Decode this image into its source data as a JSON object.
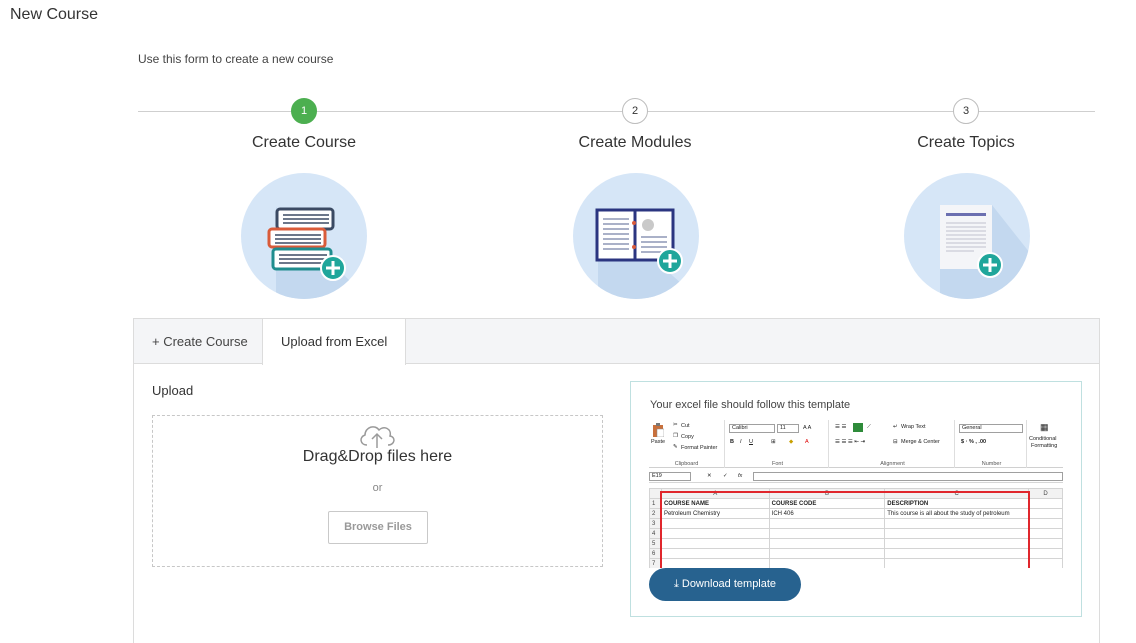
{
  "page": {
    "title": "New Course",
    "description": "Use this form to create a new course"
  },
  "steps": [
    {
      "number": "1",
      "label": "Create Course",
      "active": true
    },
    {
      "number": "2",
      "label": "Create Modules",
      "active": false
    },
    {
      "number": "3",
      "label": "Create Topics",
      "active": false
    }
  ],
  "tabs": [
    {
      "label": "+ Create Course",
      "active": false
    },
    {
      "label": "Upload from Excel",
      "active": true
    }
  ],
  "upload": {
    "label": "Upload",
    "drop_title": "Drag&Drop files here",
    "or_text": "or",
    "browse_label": "Browse Files"
  },
  "template": {
    "caption": "Your excel file should follow this template",
    "download_label": "Download template",
    "download_icon": "download-arrow-icon",
    "ribbon": {
      "paste": "Paste",
      "cut": "Cut",
      "copy": "Copy",
      "format_painter": "Format Painter",
      "clipboard": "Clipboard",
      "font_name": "Calibri",
      "font_size": "11",
      "font_group": "Font",
      "wrap_text": "Wrap Text",
      "merge_center": "Merge & Center",
      "alignment": "Alignment",
      "number_format": "General",
      "number": "Number",
      "conditional": "Conditional",
      "formatting": "Formatting"
    },
    "cell_ref": "E19",
    "fx": "fx",
    "columns": [
      "A",
      "B",
      "C",
      "D"
    ],
    "rows": [
      {
        "n": "1",
        "cells": [
          "COURSE NAME",
          "COURSE CODE",
          "DESCRIPTION",
          ""
        ]
      },
      {
        "n": "2",
        "cells": [
          "Petroleum Chemistry",
          "ICH 406",
          "This course is all about the study of petroleum",
          ""
        ]
      },
      {
        "n": "3",
        "cells": [
          "",
          "",
          "",
          ""
        ]
      },
      {
        "n": "4",
        "cells": [
          "",
          "",
          "",
          ""
        ]
      },
      {
        "n": "5",
        "cells": [
          "",
          "",
          "",
          ""
        ]
      },
      {
        "n": "6",
        "cells": [
          "",
          "",
          "",
          ""
        ]
      },
      {
        "n": "7",
        "cells": [
          "",
          "",
          "",
          ""
        ]
      }
    ]
  },
  "colors": {
    "step_active": "#4caf50",
    "download_button": "#27628f",
    "icon_circle": "#d6e6f7",
    "plus_badge": "#1fa69b",
    "template_border": "#bfe0e0",
    "excel_highlight": "#e0262c"
  }
}
